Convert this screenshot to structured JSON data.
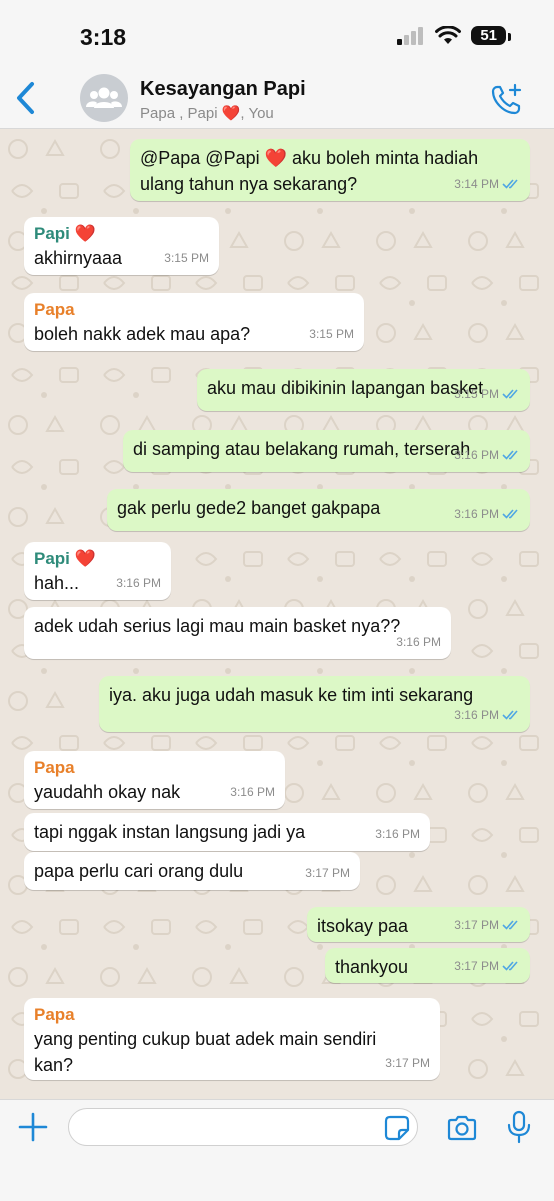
{
  "status_bar": {
    "time": "3:18",
    "battery": "51"
  },
  "header": {
    "back_icon": "chevron-left-icon",
    "avatar_icon": "group-icon",
    "title": "Kesayangan Papi",
    "subtitle": "Papa , Papi ❤️, You",
    "action_icon": "phone-add-icon"
  },
  "colors": {
    "accent": "#1E88D6",
    "outgoing": "#DCF8C6",
    "incoming": "#FFFFFF",
    "background": "#ECE5DD",
    "papi": "#2E8B7A",
    "papa": "#E8802A",
    "read_tick": "#4FA6E4"
  },
  "messages": [
    {
      "dir": "out",
      "text": "@Papa @Papi ❤️ aku boleh minta hadiah\nulang tahun nya sekarang?",
      "time": "3:14 PM",
      "read": true
    },
    {
      "dir": "in",
      "sender": "Papi ❤️",
      "text": "akhirnyaaa",
      "time": "3:15 PM"
    },
    {
      "dir": "in",
      "sender": "Papa",
      "text": "boleh nakk adek mau apa?",
      "time": "3:15 PM"
    },
    {
      "dir": "out",
      "text": "aku mau dibikinin lapangan basket",
      "time": "3:15 PM",
      "read": true
    },
    {
      "dir": "out",
      "text": "di samping atau belakang rumah, terserah",
      "time": "3:16 PM",
      "read": true
    },
    {
      "dir": "out",
      "text": "gak perlu gede2 banget gakpapa",
      "time": "3:16 PM",
      "read": true
    },
    {
      "dir": "in",
      "sender": "Papi ❤️",
      "text": "hah...",
      "time": "3:16 PM"
    },
    {
      "dir": "in",
      "text": "adek udah serius lagi mau main basket nya??",
      "time": "3:16 PM"
    },
    {
      "dir": "out",
      "text": "iya. aku juga udah masuk ke tim inti sekarang",
      "time": "3:16 PM",
      "read": true
    },
    {
      "dir": "in",
      "sender": "Papa",
      "text": "yaudahh okay nak",
      "time": "3:16 PM"
    },
    {
      "dir": "in",
      "text": "tapi nggak instan langsung jadi ya",
      "time": "3:16 PM"
    },
    {
      "dir": "in",
      "text": "papa perlu cari orang dulu",
      "time": "3:17 PM"
    },
    {
      "dir": "out",
      "text": "itsokay paa",
      "time": "3:17 PM",
      "read": true
    },
    {
      "dir": "out",
      "text": "thankyou",
      "time": "3:17 PM",
      "read": true
    },
    {
      "dir": "in",
      "sender": "Papa",
      "text": "yang penting cukup buat adek main sendiri\nkan?",
      "time": "3:17 PM"
    }
  ],
  "input_bar": {
    "plus_icon": "plus-icon",
    "sticker_icon": "sticker-icon",
    "camera_icon": "camera-icon",
    "mic_icon": "microphone-icon",
    "placeholder": ""
  }
}
